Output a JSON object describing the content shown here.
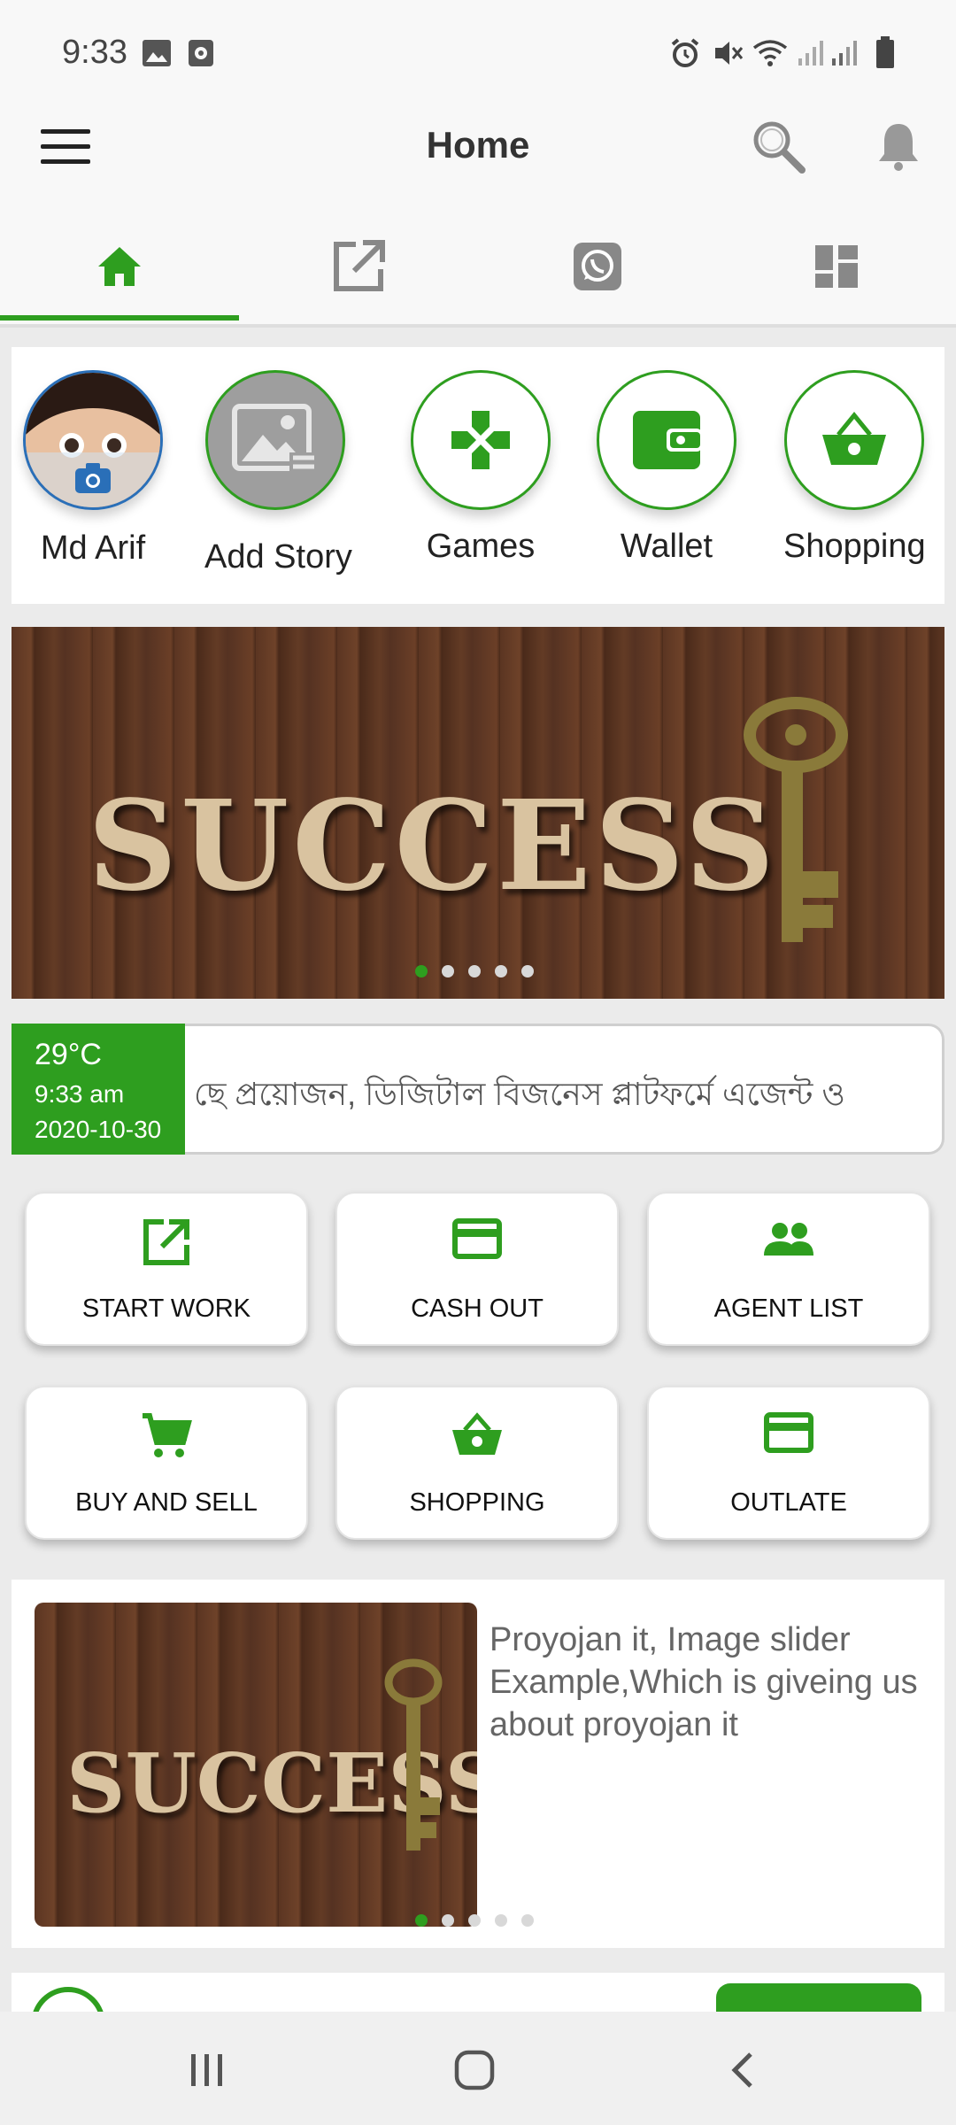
{
  "status_bar": {
    "time": "9:33"
  },
  "app_bar": {
    "title": "Home"
  },
  "tabs": [
    {
      "name": "home",
      "icon": "home-icon",
      "active": true
    },
    {
      "name": "share",
      "icon": "open-in-new-icon",
      "active": false
    },
    {
      "name": "whatsapp",
      "icon": "whatsapp-icon",
      "active": false
    },
    {
      "name": "dashboard",
      "icon": "dashboard-icon",
      "active": false
    }
  ],
  "stories": [
    {
      "label": "Md Arif",
      "icon": "avatar"
    },
    {
      "label": "Add Story",
      "icon": "image-icon"
    },
    {
      "label": "Games",
      "icon": "gamepad-icon"
    },
    {
      "label": "Wallet",
      "icon": "wallet-icon"
    },
    {
      "label": "Shopping",
      "icon": "basket-icon"
    }
  ],
  "banner": {
    "text": "SUCCESS",
    "slides": 5,
    "active_slide": 1
  },
  "weather": {
    "temperature": "29°C",
    "time": "9:33 am",
    "date": "2020-10-30",
    "ticker": "ছে প্রয়োজন, ডিজিটাল বিজনেস প্লাটফর্মে এজেন্ট ও"
  },
  "actions": [
    {
      "label": "START WORK",
      "icon": "open-in-new-icon"
    },
    {
      "label": "CASH OUT",
      "icon": "credit-card-icon"
    },
    {
      "label": "AGENT LIST",
      "icon": "people-icon"
    },
    {
      "label": "BUY AND SELL",
      "icon": "cart-icon"
    },
    {
      "label": "SHOPPING",
      "icon": "basket-icon"
    },
    {
      "label": "OUTLATE",
      "icon": "credit-card-icon"
    }
  ],
  "news": {
    "image_text": "SUCCESS",
    "text": "Proyojan it, Image slider Example,Which is giveing us about proyojan it",
    "slides": 5,
    "active_slide": 1
  },
  "colors": {
    "accent": "#2e9e1f",
    "background": "#ebebeb"
  }
}
